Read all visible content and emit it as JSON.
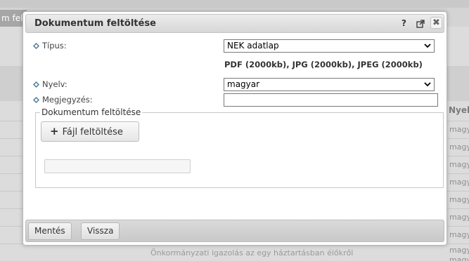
{
  "background": {
    "tab_label": "m fel",
    "column_header": "Nyelv",
    "column_cells": [
      "magy",
      "magy",
      "magy",
      "magy",
      "magy",
      "magy",
      "magy",
      "magy",
      "magy"
    ],
    "footer_text": "Önkormányzati igazolás az egy háztartásban élőkről"
  },
  "dialog": {
    "title": "Dokumentum feltöltése",
    "help_label": "?",
    "close_label": "✖",
    "fields": {
      "type_label": "Típus:",
      "type_value": "NEK adatlap",
      "formats_text": "PDF (2000kb), JPG (2000kb), JPEG (2000kb)",
      "language_label": "Nyelv:",
      "language_value": "magyar",
      "note_label": "Megjegyzés:",
      "note_value": ""
    },
    "upload_section": {
      "legend": "Dokumentum feltöltése",
      "upload_button": "Fájl feltöltése",
      "progress": 0
    },
    "footer": {
      "save_button": "Mentés",
      "back_button": "Vissza"
    }
  },
  "colors": {
    "progress_fill": "#9ec0e8",
    "required_marker": "#4a7a99"
  }
}
